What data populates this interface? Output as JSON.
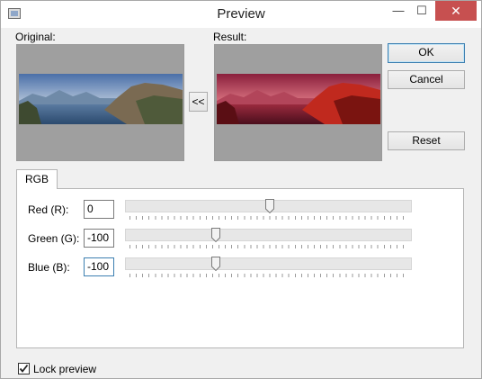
{
  "window": {
    "title": "Preview",
    "close_glyph": "✕",
    "minimize_glyph": "—",
    "maximize_glyph": "☐"
  },
  "preview": {
    "original_label": "Original:",
    "result_label": "Result:",
    "swap_label": "<<"
  },
  "buttons": {
    "ok": "OK",
    "cancel": "Cancel",
    "reset": "Reset"
  },
  "tabs": [
    {
      "label": "RGB"
    }
  ],
  "channels": [
    {
      "label": "Red (R):",
      "value": "0",
      "slider_fraction": 0.5
    },
    {
      "label": "Green (G):",
      "value": "-100",
      "slider_fraction": 0.31
    },
    {
      "label": "Blue (B):",
      "value": "-100",
      "slider_fraction": 0.31
    }
  ],
  "lock_preview": {
    "label": "Lock preview",
    "checked": true
  },
  "colors": {
    "accent": "#3c7fb1",
    "close_red": "#c75050",
    "placeholder_gray": "#9f9f9f"
  }
}
